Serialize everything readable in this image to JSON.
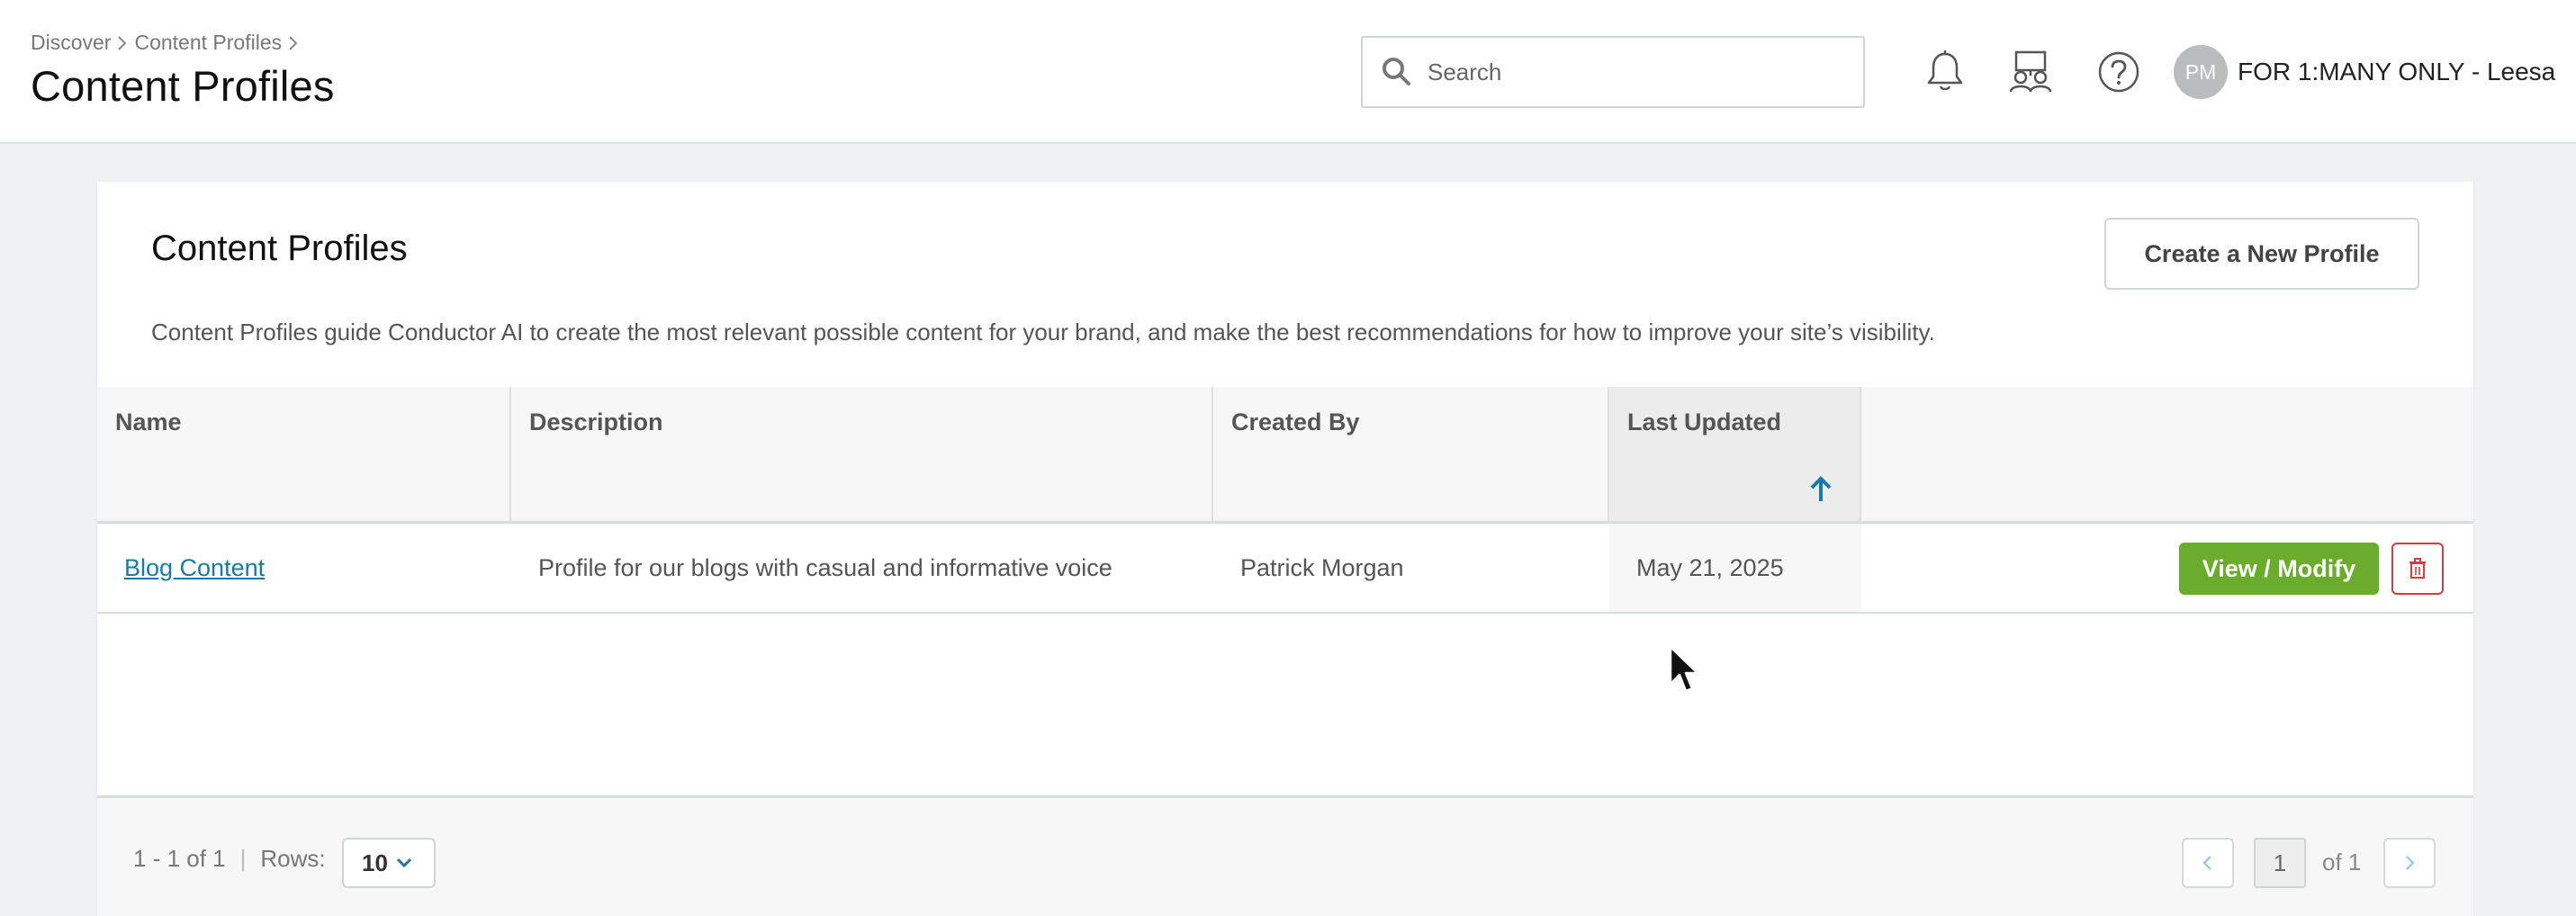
{
  "header": {
    "breadcrumb": [
      "Discover",
      "Content Profiles"
    ],
    "title": "Content Profiles",
    "search_placeholder": "Search",
    "user_initials": "PM",
    "user_name": "FOR 1:MANY ONLY - Leesa"
  },
  "card": {
    "title": "Content Profiles",
    "create_button": "Create a New Profile",
    "description": "Content Profiles guide Conductor AI to create the most relevant possible content for your brand, and make the best recommendations for how to improve your site’s visibility."
  },
  "table": {
    "columns": [
      "Name",
      "Description",
      "Created By",
      "Last Updated"
    ],
    "sorted_column": "Last Updated",
    "sort_direction": "ascending",
    "rows": [
      {
        "name": "Blog Content",
        "description": "Profile for our blogs with casual and informative voice",
        "created_by": "Patrick Morgan",
        "last_updated": "May 21, 2025",
        "action": "View / Modify"
      }
    ]
  },
  "pagination": {
    "range": "1 - 1 of 1",
    "rows_label": "Rows:",
    "rows_value": "10",
    "current_page": "1",
    "of_pages": "of 1"
  },
  "colors": {
    "accent_link": "#1a7aa6",
    "primary_button": "#6aad2d",
    "danger": "#d33d3d",
    "sort_arrow": "#1a7aa6"
  }
}
